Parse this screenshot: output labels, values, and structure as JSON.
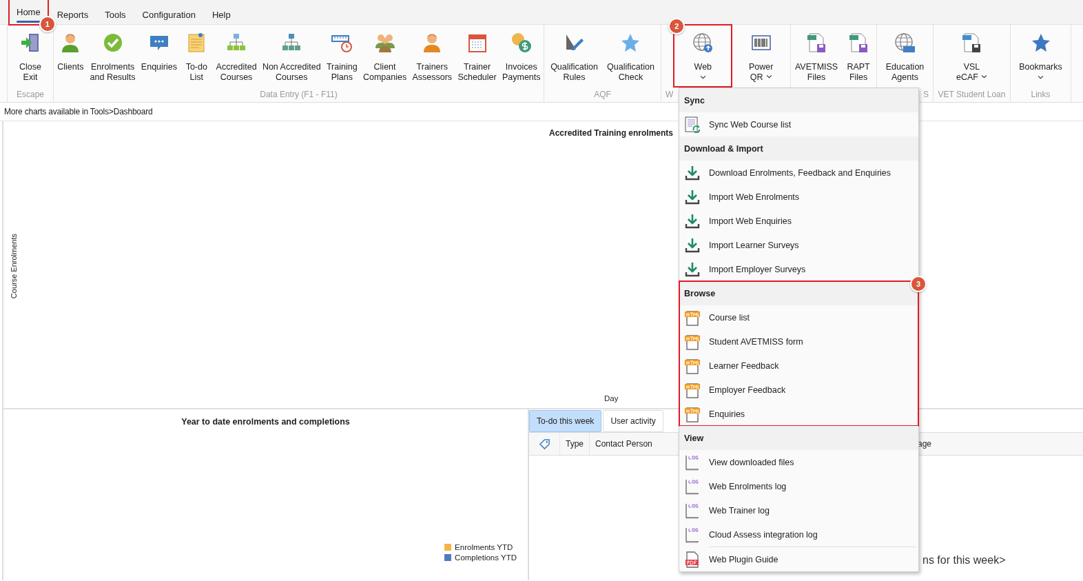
{
  "tabs": [
    {
      "label": "Home",
      "selected": true,
      "callout": "1"
    },
    {
      "label": "Reports",
      "selected": false
    },
    {
      "label": "Tools",
      "selected": false
    },
    {
      "label": "Configuration",
      "selected": false
    },
    {
      "label": "Help",
      "selected": false
    }
  ],
  "ribbon": {
    "groups": [
      {
        "label": "Escape",
        "buttons": [
          {
            "label": "Close\nExit",
            "dropdown": false
          }
        ]
      },
      {
        "label": "Data Entry (F1 - F11)",
        "buttons": [
          {
            "label": "Clients",
            "dropdown": false
          },
          {
            "label": "Enrolments\nand Results",
            "dropdown": false
          },
          {
            "label": "Enquiries",
            "dropdown": false
          },
          {
            "label": "To-do\nList",
            "dropdown": false
          },
          {
            "label": "Accredited\nCourses",
            "dropdown": false
          },
          {
            "label": "Non Accredited\nCourses",
            "dropdown": false
          },
          {
            "label": "Training\nPlans",
            "dropdown": false
          },
          {
            "label": "Client\nCompanies",
            "dropdown": false
          },
          {
            "label": "Trainers\nAssessors",
            "dropdown": false
          },
          {
            "label": "Trainer\nScheduler",
            "dropdown": false
          },
          {
            "label": "Invoices\nPayments",
            "dropdown": false
          }
        ]
      },
      {
        "label": "AQF",
        "buttons": [
          {
            "label": "Qualification\nRules",
            "dropdown": false
          },
          {
            "label": "Qualification\nCheck",
            "dropdown": false
          }
        ]
      },
      {
        "label": "W",
        "buttons": [
          {
            "label": "Web",
            "dropdown": true,
            "callout": "2"
          },
          {
            "label": "Power\nQR",
            "dropdown": true
          }
        ]
      },
      {
        "buttons": [
          {
            "label": "AVETMISS\nFiles",
            "dropdown": false
          },
          {
            "label": "RAPT\nFiles",
            "dropdown": false
          }
        ]
      },
      {
        "label": "S",
        "buttons": [
          {
            "label": "Education\nAgents",
            "dropdown": false
          }
        ]
      },
      {
        "label": "VET Student Loan",
        "buttons": [
          {
            "label": "VSL\neCAF",
            "dropdown": true
          }
        ]
      },
      {
        "label": "Links",
        "buttons": [
          {
            "label": "Bookmarks",
            "dropdown": true
          }
        ]
      }
    ]
  },
  "info_line": "More charts available in Tools>Dashboard",
  "enrolments_chart": {
    "title": "Accredited Training enrolments",
    "ylabel": "Course Enrolments",
    "xlabel": "Day"
  },
  "ytd_chart": {
    "title": "Year to date enrolments and completions",
    "legend": [
      {
        "label": "Enrolments YTD",
        "color": "#f5b54a"
      },
      {
        "label": "Completions YTD",
        "color": "#4f7bbd"
      }
    ]
  },
  "activity_panel": {
    "tabs": [
      {
        "label": "To-do this week",
        "selected": true
      },
      {
        "label": "User activity",
        "selected": false
      }
    ],
    "columns": [
      "Type",
      "Contact Person"
    ],
    "column_4": "age",
    "message": "ns for this week>"
  },
  "web_menu": {
    "sections": [
      {
        "title": "Sync",
        "items": [
          {
            "label": "Sync Web Course list",
            "kind": "sync"
          }
        ]
      },
      {
        "title": "Download & Import",
        "items": [
          {
            "label": "Download Enrolments, Feedback and Enquiries",
            "kind": "download"
          },
          {
            "label": "Import Web Enrolments",
            "kind": "download"
          },
          {
            "label": "Import Web Enquiries",
            "kind": "download"
          },
          {
            "label": "Import Learner Surveys",
            "kind": "download"
          },
          {
            "label": "Import Employer Surveys",
            "kind": "download"
          }
        ]
      },
      {
        "title": "Browse",
        "callout": "3",
        "items": [
          {
            "label": "Course list",
            "kind": "html"
          },
          {
            "label": "Student AVETMISS form",
            "kind": "html"
          },
          {
            "label": "Learner Feedback",
            "kind": "html"
          },
          {
            "label": "Employer Feedback",
            "kind": "html"
          },
          {
            "label": "Enquiries",
            "kind": "html"
          }
        ]
      },
      {
        "title": "View",
        "items": [
          {
            "label": "View downloaded files",
            "kind": "log"
          },
          {
            "label": "Web Enrolments log",
            "kind": "log"
          },
          {
            "label": "Web Trainer log",
            "kind": "log"
          },
          {
            "label": "Cloud Assess integration log",
            "kind": "log"
          }
        ]
      }
    ],
    "footer_items": [
      {
        "label": "Web Plugin Guide",
        "kind": "pdf"
      }
    ]
  }
}
